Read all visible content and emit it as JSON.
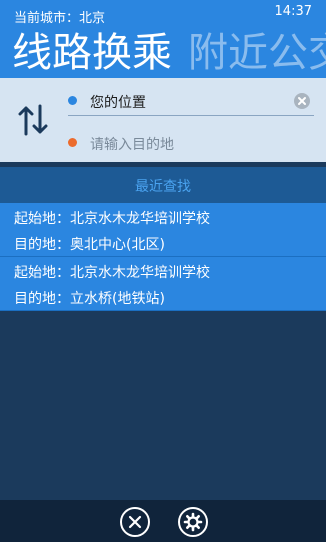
{
  "status": {
    "time": "14:37"
  },
  "header": {
    "current_city": "当前城市：北京",
    "pivots": [
      {
        "label": "线路换乘",
        "active": true
      },
      {
        "label": "附近公交",
        "active": false
      }
    ]
  },
  "search": {
    "from_value": "您的位置",
    "to_placeholder": "请输入目的地"
  },
  "recent": {
    "title": "最近查找",
    "items": [
      {
        "start": "起始地：北京水木龙华培训学校",
        "end": "目的地：奥北中心(北区)"
      },
      {
        "start": "起始地：北京水木龙华培训学校",
        "end": "目的地：立水桥(地铁站)"
      }
    ]
  },
  "app_bar": {
    "buttons": [
      {
        "icon": "close-icon"
      },
      {
        "icon": "gear-icon"
      }
    ]
  },
  "colors": {
    "accent": "#2b86e0",
    "panel": "#d6e4f2",
    "background": "#1b3a5c",
    "destination_dot": "#ec6b2d"
  }
}
